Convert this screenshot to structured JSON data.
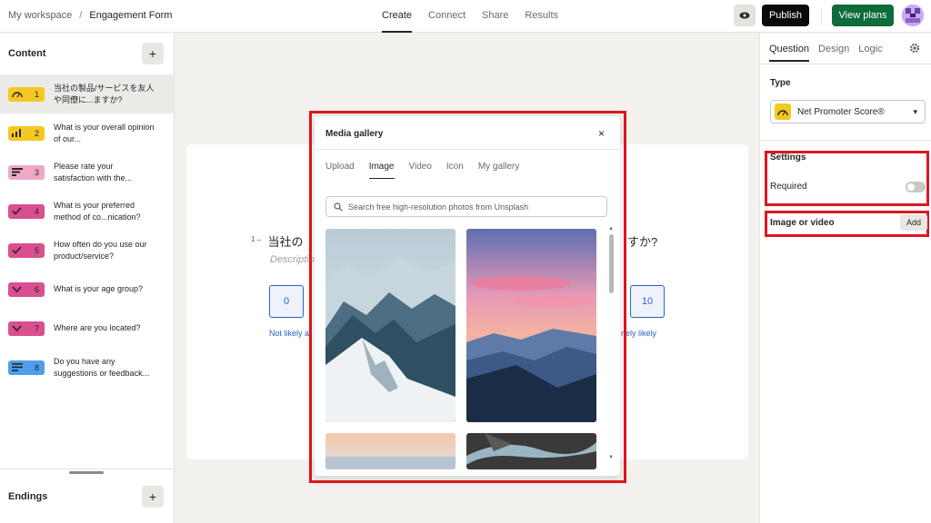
{
  "header": {
    "breadcrumb": {
      "workspace": "My workspace",
      "separator": "/",
      "form": "Engagement Form"
    },
    "tabs": [
      {
        "label": "Create",
        "active": true
      },
      {
        "label": "Connect",
        "active": false
      },
      {
        "label": "Share",
        "active": false
      },
      {
        "label": "Results",
        "active": false
      }
    ],
    "publish_label": "Publish",
    "plans_label": "View plans"
  },
  "sidebar": {
    "title": "Content",
    "items": [
      {
        "num": "1",
        "text": "当社の製品/サービスを友人や同僚に...ますか?",
        "color": "#f5c723",
        "icon": "gauge-icon"
      },
      {
        "num": "2",
        "text": "What is your overall opinion of our...",
        "color": "#f5c723",
        "icon": "bar-chart-icon"
      },
      {
        "num": "3",
        "text": "Please rate your satisfaction with the...",
        "color": "#f0a8c8",
        "icon": "matrix-icon"
      },
      {
        "num": "4",
        "text": "What is your preferred method of co...nication?",
        "color": "#d94f8f",
        "icon": "check-icon"
      },
      {
        "num": "5",
        "text": "How often do you use our product/service?",
        "color": "#d94f8f",
        "icon": "check-icon"
      },
      {
        "num": "6",
        "text": "What is your age group?",
        "color": "#d94f8f",
        "icon": "chevron-icon"
      },
      {
        "num": "7",
        "text": "Where are you located?",
        "color": "#d94f8f",
        "icon": "chevron-icon"
      },
      {
        "num": "8",
        "text": "Do you have any suggestions or feedback...",
        "color": "#4d9fe8",
        "icon": "text-icon"
      }
    ],
    "endings_title": "Endings"
  },
  "canvas": {
    "question_num": "1",
    "question_start": "当社の",
    "question_end": "すか?",
    "description": "Descriptio",
    "score_min": "0",
    "score_max": "10",
    "label_left": "Not likely at",
    "label_right": "nely likely"
  },
  "right_panel": {
    "tabs": [
      {
        "label": "Question",
        "active": true
      },
      {
        "label": "Design",
        "active": false
      },
      {
        "label": "Logic",
        "active": false
      }
    ],
    "type_label": "Type",
    "type_value": "Net Promoter Score®",
    "settings_label": "Settings",
    "required_label": "Required",
    "required_on": false,
    "image_label": "Image or video",
    "add_label": "Add"
  },
  "modal": {
    "title": "Media gallery",
    "close": "×",
    "tabs": [
      {
        "label": "Upload",
        "active": false
      },
      {
        "label": "Image",
        "active": true
      },
      {
        "label": "Video",
        "active": false
      },
      {
        "label": "Icon",
        "active": false
      },
      {
        "label": "My gallery",
        "active": false
      }
    ],
    "search_placeholder": "Search free high-resolution photos from Unsplash"
  }
}
